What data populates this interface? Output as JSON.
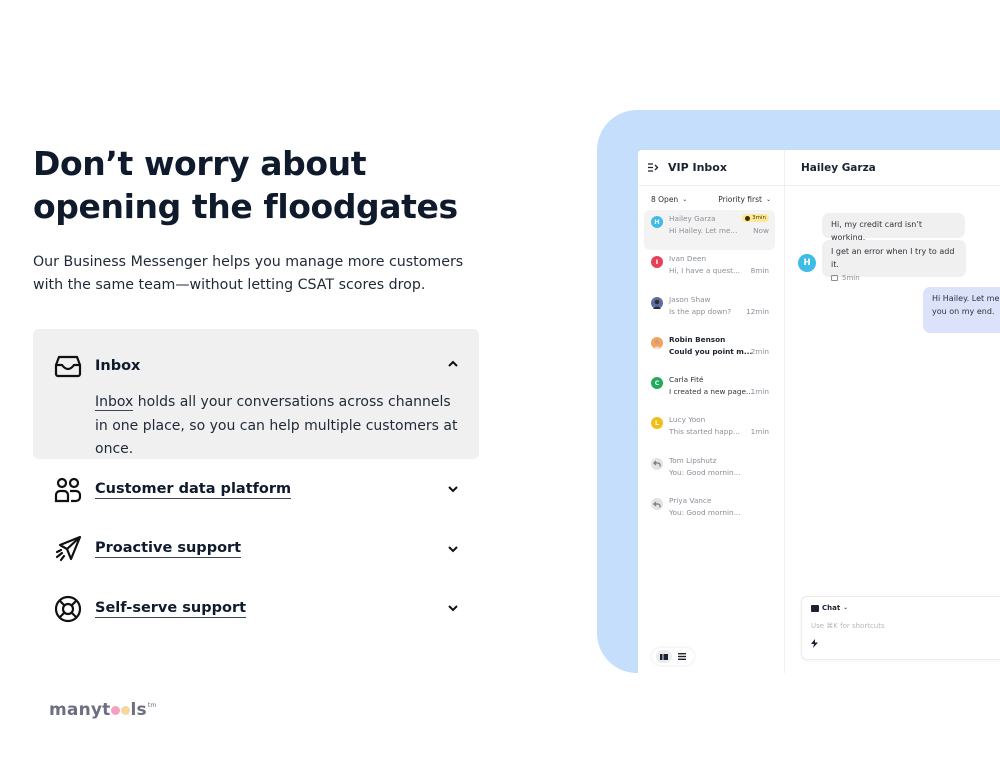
{
  "hero": {
    "headline": "Don’t worry about opening the floodgates",
    "subtext": "Our Business Messenger helps you manage more customers with the same team—without letting CSAT scores drop."
  },
  "accordion": {
    "items": [
      {
        "icon": "inbox-tray-icon",
        "title": "Inbox",
        "expanded": true,
        "body_link": "Inbox",
        "body_rest": " holds all your conversations across channels in one place, so you can help multiple customers at once."
      },
      {
        "icon": "users-icon",
        "title": "Customer data platform",
        "expanded": false
      },
      {
        "icon": "paper-plane-icon",
        "title": "Proactive support",
        "expanded": false
      },
      {
        "icon": "lifebuoy-icon",
        "title": "Self-serve support",
        "expanded": false
      }
    ]
  },
  "logo": {
    "part1": "manyt",
    "part2": "ls",
    "tm": "tm",
    "dot_colors": [
      "#f59fc1",
      "#f7d79b"
    ]
  },
  "app": {
    "inbox": {
      "title": "VIP Inbox",
      "filter_open": "8 Open",
      "filter_sort": "Priority first",
      "conversations": [
        {
          "initial": "H",
          "color": "#3ebbe6",
          "name": "Hailey Garza",
          "preview": "Hi Hailey. Let me...",
          "time": "Now",
          "badge": "3min",
          "active": true,
          "style": "muted"
        },
        {
          "initial": "I",
          "color": "#e5425a",
          "name": "Ivan Deen",
          "preview": "Hi, I have a quest...",
          "time": "8min",
          "style": "muted"
        },
        {
          "initial": "",
          "color": "#5a6ea8",
          "name": "Jason Shaw",
          "preview": "Is the app down?",
          "time": "12min",
          "style": "muted",
          "photo": true
        },
        {
          "initial": "",
          "color": "#f3a35c",
          "name": "Robin Benson",
          "preview": "Could you point m...",
          "time": "2min",
          "style": "bold",
          "photo": true
        },
        {
          "initial": "C",
          "color": "#1fab5a",
          "name": "Carla Fité",
          "preview": "I created a new page...",
          "time": "1min",
          "style": "dark"
        },
        {
          "initial": "L",
          "color": "#f1bd16",
          "name": "Lucy Yoon",
          "preview": "This started happ...",
          "time": "1min",
          "style": "muted"
        },
        {
          "initial": "↶",
          "color": "#e2e2e2",
          "name": "Tom Lipshutz",
          "preview": "You: Good mornin...",
          "time": "",
          "style": "muted",
          "reply": true
        },
        {
          "initial": "↶",
          "color": "#e2e2e2",
          "name": "Priya Vance",
          "preview": "You: Good mornin...",
          "time": "",
          "style": "muted",
          "reply": true
        }
      ]
    },
    "chat": {
      "title": "Hailey Garza",
      "customer_initial": "H",
      "messages": [
        {
          "from": "customer",
          "text": "Hi, my credit card isn’t working."
        },
        {
          "from": "customer",
          "text": "I get an error when I try to add it.",
          "meta": "5min"
        },
        {
          "from": "agent",
          "text": "Hi Hailey. Let me check this for you on my end."
        }
      ],
      "agent_visible_line1": "Hi Hailey. Let me c",
      "agent_visible_line2": "you on my end.",
      "composer": {
        "channel": "Chat",
        "placeholder": "Use ⌘K for shortcuts"
      }
    }
  },
  "colors": {
    "heading": "#0f1b2d",
    "panel_blue": "#c5defb",
    "accordion_bg": "#f0f0f0",
    "agent_bubble": "#dde2fb",
    "customer_bubble": "#f0f0f0"
  }
}
